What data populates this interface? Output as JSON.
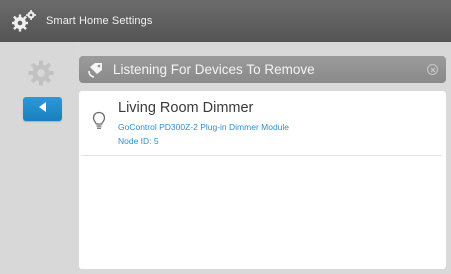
{
  "app": {
    "title": "Smart Home Settings",
    "icon": "gears-icon"
  },
  "sidebar": {
    "settings_icon": "gear-icon",
    "back_icon": "back-arrow-icon"
  },
  "header": {
    "text": "Listening For Devices To Remove",
    "icon": "broadcast-tag-icon",
    "close_icon": "close-circle-icon"
  },
  "devices": [
    {
      "name": "Living Room Dimmer",
      "model": "GoControl PD300Z-2 Plug-in Dimmer Module",
      "node": "Node ID: 5",
      "icon": "light-bulb-icon"
    }
  ],
  "colors": {
    "accent": "#1f8ccf",
    "titlebar": "#5e5e5e",
    "header": "#939393",
    "background": "#d9d9d9"
  }
}
